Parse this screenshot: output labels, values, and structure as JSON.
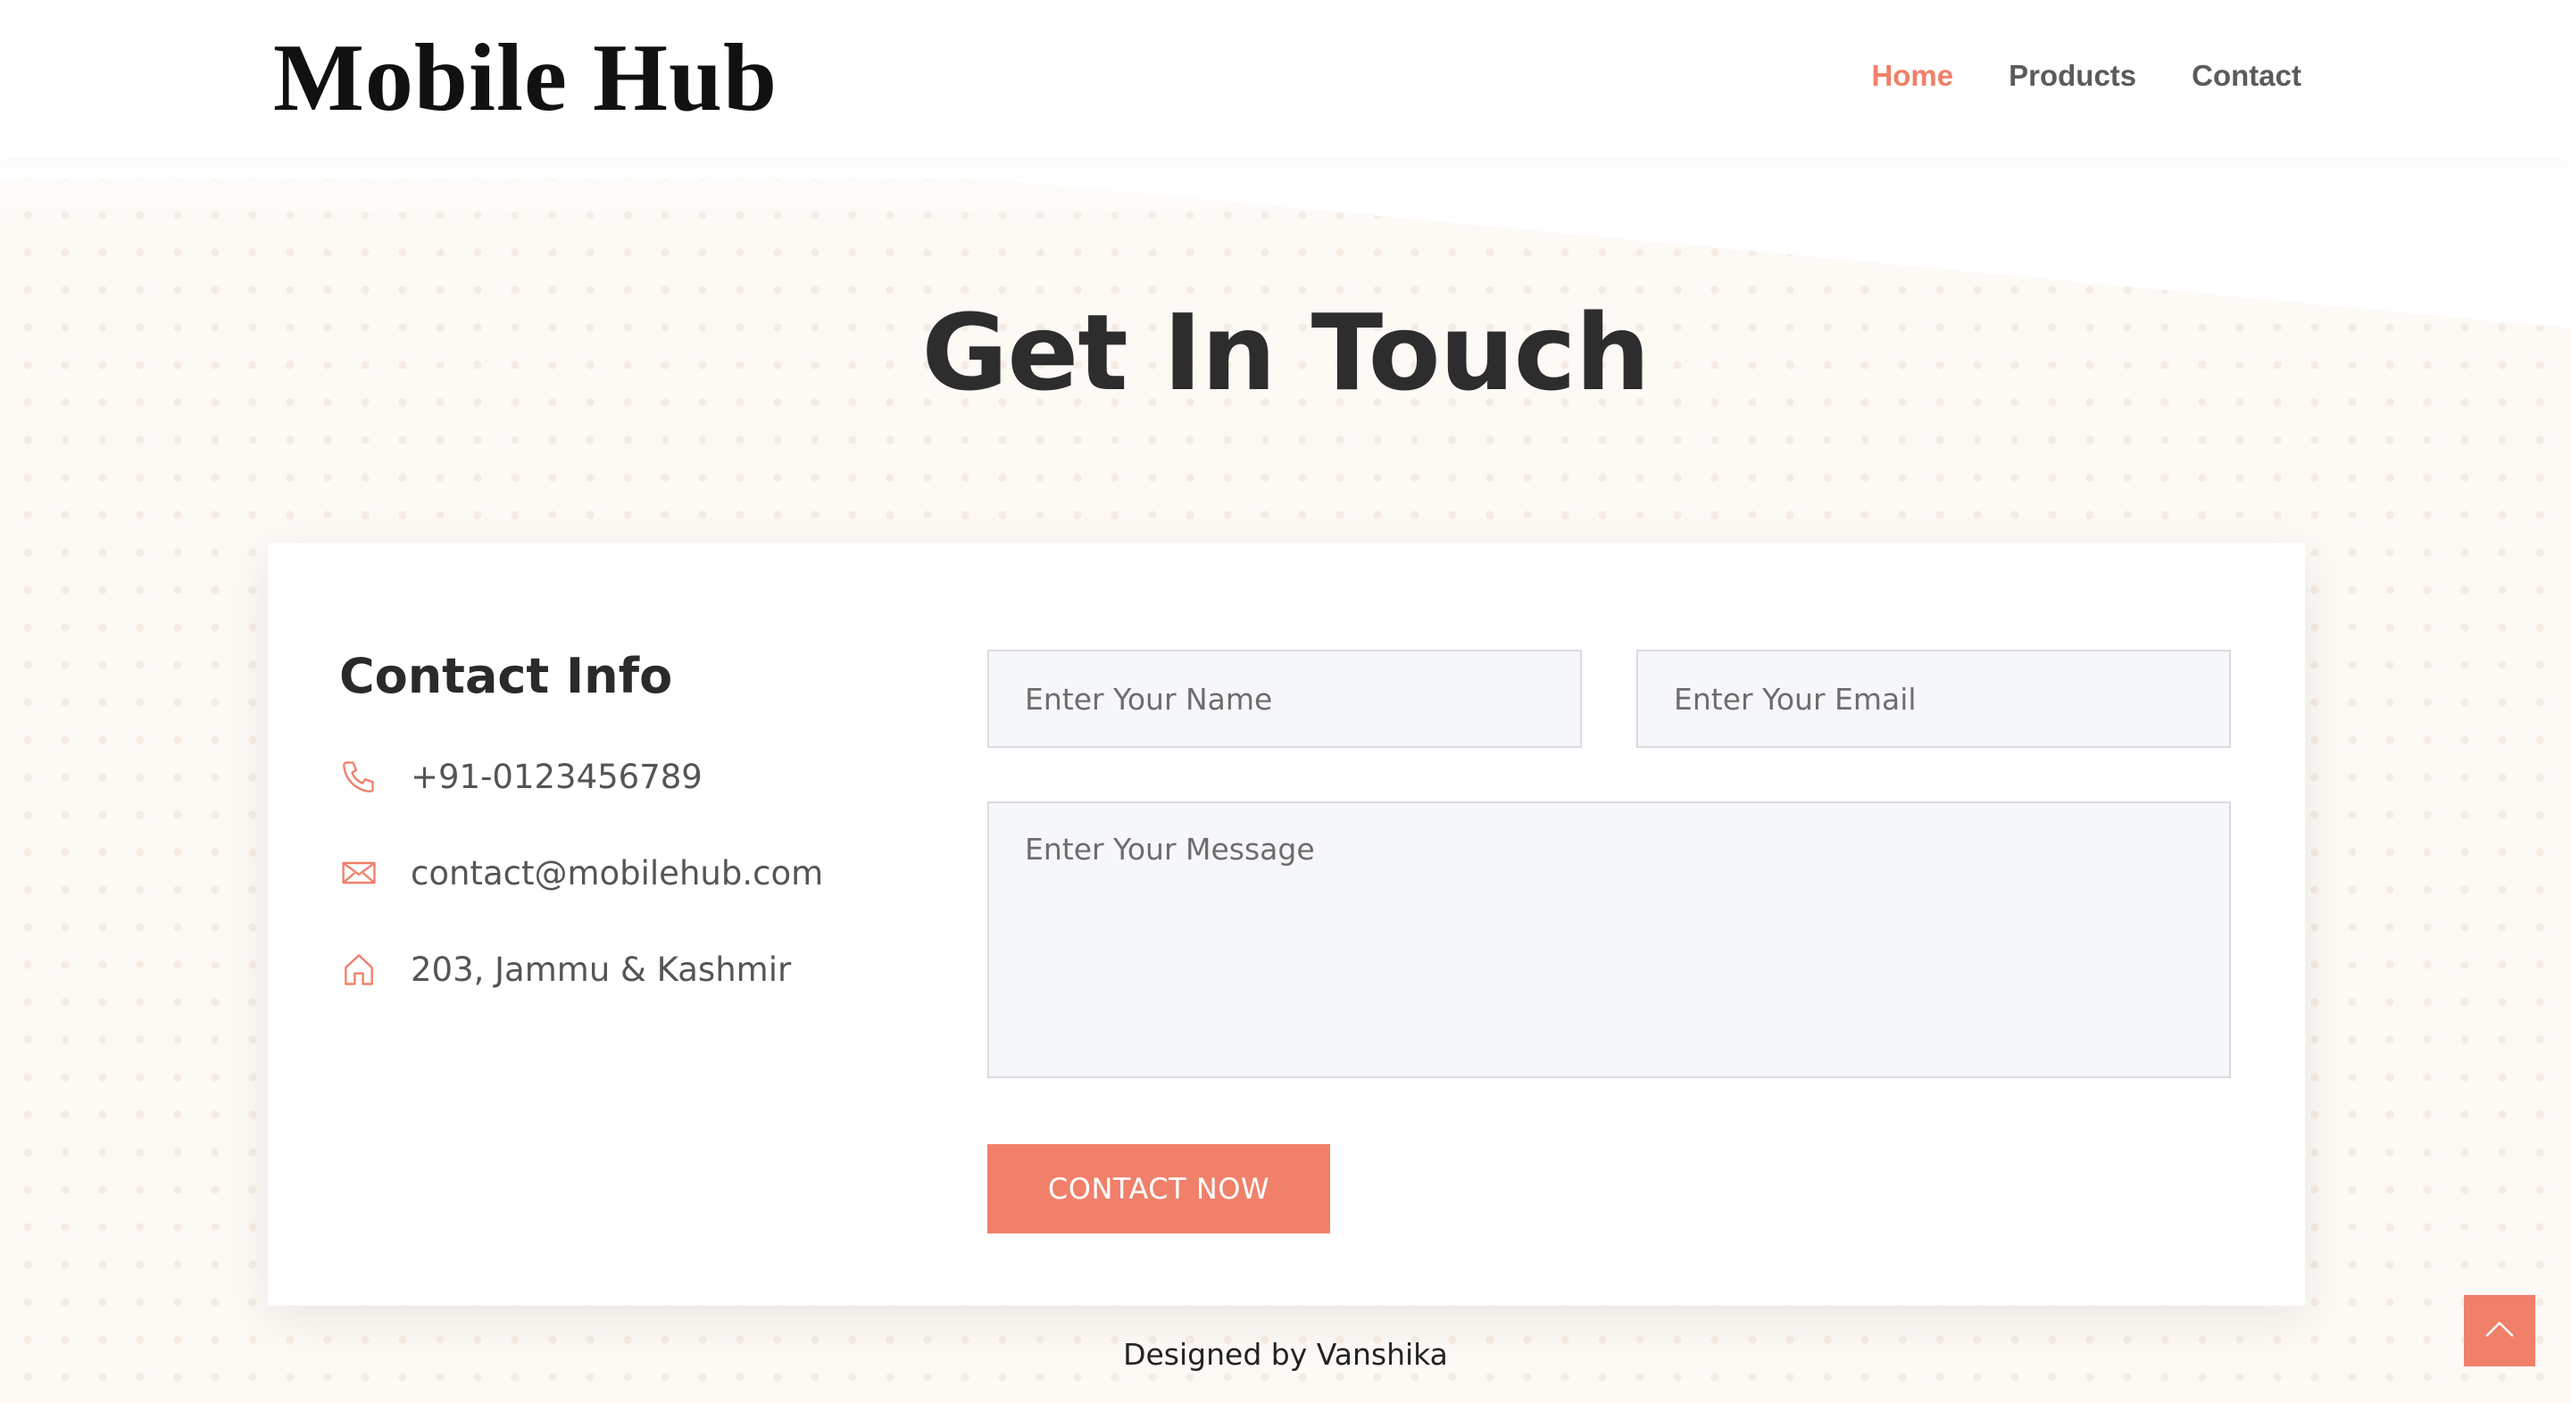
{
  "header": {
    "logo": "Mobile Hub",
    "nav": [
      {
        "label": "Home",
        "active": true
      },
      {
        "label": "Products",
        "active": false
      },
      {
        "label": "Contact",
        "active": false
      }
    ]
  },
  "hero": {
    "title": "Get In Touch"
  },
  "contact_info": {
    "title": "Contact Info",
    "items": [
      {
        "icon": "phone-icon",
        "text": "+91-0123456789"
      },
      {
        "icon": "envelope-icon",
        "text": "contact@mobilehub.com"
      },
      {
        "icon": "home-icon",
        "text": "203, Jammu & Kashmir"
      }
    ]
  },
  "form": {
    "name_placeholder": "Enter Your Name",
    "email_placeholder": "Enter Your Email",
    "message_placeholder": "Enter Your Message",
    "submit_label": "CONTACT NOW"
  },
  "footer": {
    "credit": "Designed by Vanshika"
  },
  "back_to_top": {
    "icon": "chevron-up-icon"
  },
  "colors": {
    "accent": "#f0806a",
    "heading": "#2d2d2d",
    "body_background": "#fdf9f5",
    "input_background": "#f6f7fb"
  }
}
